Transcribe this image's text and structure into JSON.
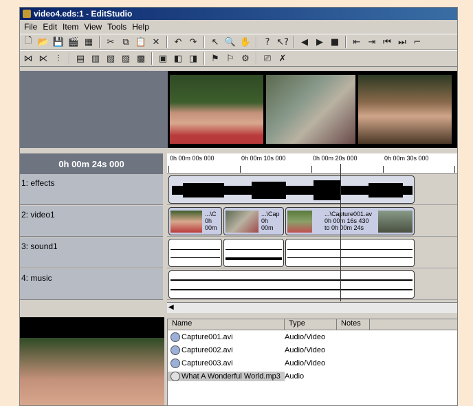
{
  "window": {
    "title": "video4.eds:1 - EditStudio"
  },
  "menu": [
    "File",
    "Edit",
    "Item",
    "View",
    "Tools",
    "Help"
  ],
  "toolbar1": [
    "new-icon",
    "open-icon",
    "save-icon",
    "clapper-icon",
    "film-icon",
    "cut-icon",
    "copy-icon",
    "paste-icon",
    "delete-icon",
    "undo-icon",
    "redo-icon",
    "select-icon",
    "zoom-icon",
    "hand-icon",
    "help-icon",
    "context-help-icon",
    "play-back-icon",
    "play-icon",
    "stop-icon",
    "prev-clip-icon",
    "next-clip-icon",
    "prev-marker-icon",
    "next-marker-icon",
    "marker-icon"
  ],
  "toolbar2": [
    "split-icon",
    "join-icon",
    "trim-icon",
    "split-clip-icon",
    "insert-icon",
    "overwrite-icon",
    "extract-icon",
    "lift-icon",
    "title-icon",
    "transition-icon",
    "effect-icon",
    "flag-in-icon",
    "flag-out-icon",
    "properties-icon",
    "render-icon",
    "clear-icon"
  ],
  "timecode": "0h 00m 24s 000",
  "ruler": [
    "0h 00m 00s 000",
    "0h 00m 10s 000",
    "0h 00m 20s 000",
    "0h 00m 30s 000"
  ],
  "tracks": [
    "1: effects",
    "2: video1",
    "3: sound1",
    "4: music"
  ],
  "video_clips": [
    {
      "name": "...\\C",
      "time": "0h",
      "end": "00m"
    },
    {
      "name": "...\\Cap",
      "time": "0h",
      "end": "00m"
    },
    {
      "name": "...\\Capture001.av",
      "time": "0h 00m 16s 430",
      "end": "to 0h 00m 24s"
    }
  ],
  "bin": {
    "columns": [
      "Name",
      "Type",
      "Notes"
    ],
    "rows": [
      {
        "name": "Capture001.avi",
        "type": "Audio/Video"
      },
      {
        "name": "Capture002.avi",
        "type": "Audio/Video"
      },
      {
        "name": "Capture003.avi",
        "type": "Audio/Video"
      },
      {
        "name": "What A Wonderful World.mp3",
        "type": "Audio"
      }
    ]
  },
  "colors": {
    "titlebar": "#0a246a",
    "track_label": "#b7bbc4",
    "clip": "#c8cce4"
  }
}
